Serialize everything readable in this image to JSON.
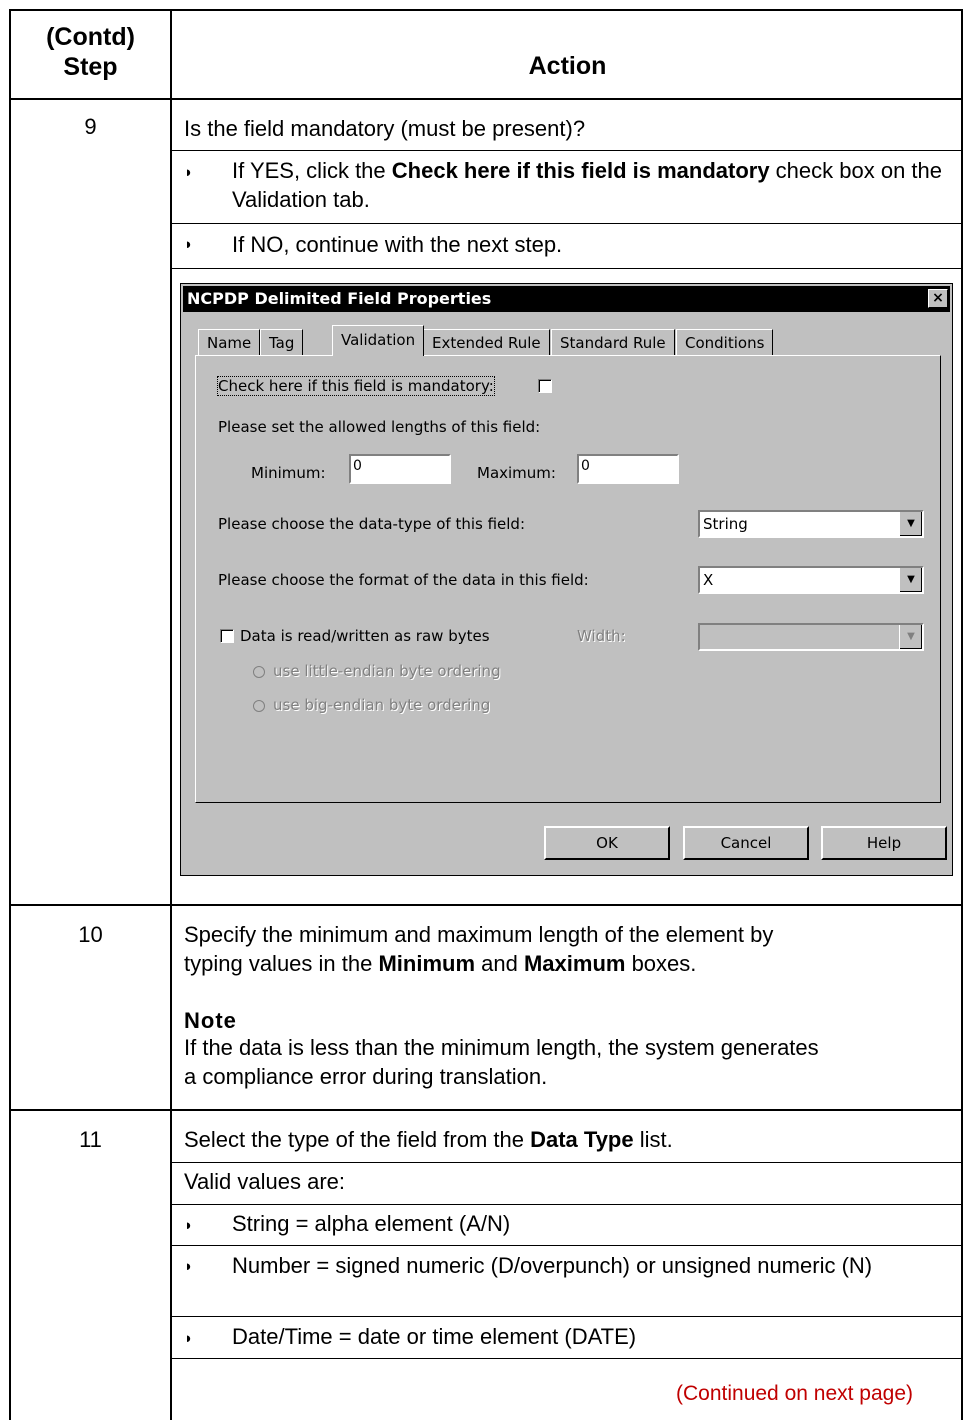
{
  "header": {
    "step_line1": "(Contd)",
    "step_line2": "Step",
    "action": "Action"
  },
  "step9": {
    "number": "9",
    "question": "Is the field mandatory (must be present)?",
    "bullet1_pre": "If YES, click the ",
    "bullet1_bold": "Check here if this field is mandatory",
    "bullet1_post": " check box on the Validation tab.",
    "bullet2": "If NO, continue with the next step."
  },
  "dialog": {
    "title": "NCPDP Delimited Field Properties",
    "close_glyph": "×",
    "tabs": [
      "Name",
      "Tag",
      "Validation",
      "Extended Rule",
      "Standard Rule",
      "Conditions"
    ],
    "mandatory_label": "Check here if this field is mandatory:",
    "lengths_label": "Please set the allowed lengths of this field:",
    "minimum_label": "Minimum:",
    "minimum_value": "0",
    "maximum_label": "Maximum:",
    "maximum_value": "0",
    "datatype_label": "Please choose the data-type of this field:",
    "datatype_value": "String",
    "format_label": "Please choose the format of the data in this field:",
    "format_value": "X",
    "raw_bytes_label": "Data is read/written as raw bytes",
    "width_label": "Width:",
    "width_value": "",
    "little_endian_label": "use little-endian byte ordering",
    "big_endian_label": "use big-endian byte ordering",
    "ok": "OK",
    "cancel": "Cancel",
    "help": "Help"
  },
  "step10": {
    "number": "10",
    "line1": "Specify the minimum and maximum length of the element by",
    "line2_pre": "typing values in the ",
    "line2_b1": "Minimum",
    "line2_mid": " and ",
    "line2_b2": "Maximum",
    "line2_post": " boxes.",
    "note_heading": "Note",
    "note_line1": "If the data is less than the minimum length, the system generates",
    "note_line2": "a compliance error during translation."
  },
  "step11": {
    "number": "11",
    "line1_pre": "Select the type of the field from the ",
    "line1_bold": "Data Type",
    "line1_post": " list.",
    "valid": "Valid values are:",
    "bullets": [
      "String = alpha element (A/N)",
      "Number = signed numeric (D/overpunch) or unsigned numeric (N)",
      "Date/Time = date or time element (DATE)"
    ]
  },
  "continued": "(Continued on next page)",
  "bullet_glyph": "◗"
}
